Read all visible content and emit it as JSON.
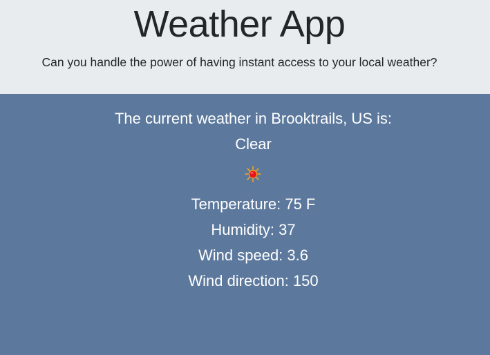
{
  "header": {
    "title": "Weather App",
    "lead": "Can you handle the power of having instant access to your local weather?"
  },
  "weather": {
    "location_heading": "The current weather in Brooktrails, US is:",
    "condition": "Clear",
    "condition_icon": "sun-icon",
    "temperature": "Temperature: 75 F",
    "humidity": "Humidity: 37",
    "wind_speed": "Wind speed: 3.6",
    "wind_direction": "Wind direction: 150"
  },
  "colors": {
    "header_bg": "#e9ecef",
    "panel_bg": "#5c799d",
    "sun_core": "#e8141c",
    "sun_rays": "#f5a623"
  }
}
